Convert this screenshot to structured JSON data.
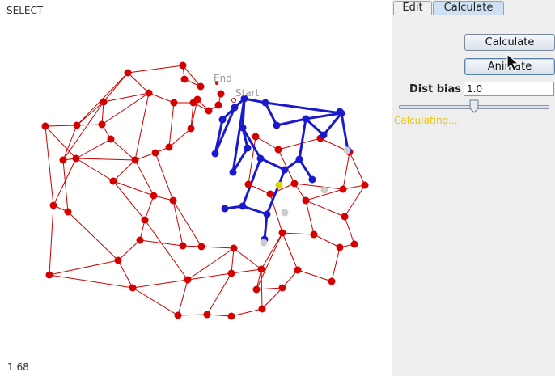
{
  "canvas": {
    "mode_label": "SELECT",
    "scale_label": "1.68",
    "end_label": "End",
    "start_label": "Start"
  },
  "panel": {
    "tabs": [
      {
        "label": "Edit",
        "active": false
      },
      {
        "label": "Calculate",
        "active": true
      }
    ],
    "calculate_button": "Calculate",
    "animate_button": "Animate",
    "dist_bias_label": "Dist bias",
    "dist_bias_value": "1.0",
    "dist_bias_slider_fraction": 0.5,
    "status": "Calculating..."
  },
  "colors": {
    "graph_node": "#d40000",
    "graph_edge": "#cc0000",
    "path_node": "#1a1acc",
    "path_edge": "#1a1acc",
    "visited_node": "#cccccc",
    "current_node": "#d8d800",
    "status_text": "#e8c41a",
    "tab_active": "#cfe0f2"
  }
}
